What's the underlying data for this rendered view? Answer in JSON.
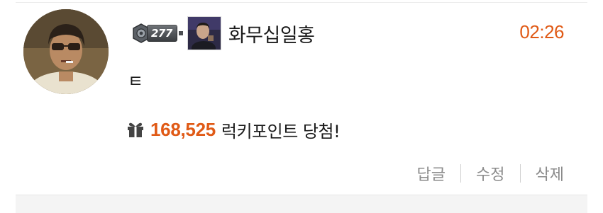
{
  "comment": {
    "level": "277",
    "nickname": "화무십일홍",
    "time": "02:26",
    "text": "ㅌ",
    "lucky": {
      "points": "168,525",
      "label": "럭키포인트 당첨!"
    },
    "actions": {
      "reply": "답글",
      "edit": "수정",
      "delete": "삭제"
    }
  },
  "icons": {
    "avatar": "user-photo-avatar",
    "level": "level-emblem-icon",
    "mini_avatar": "profile-thumbnail",
    "gift": "gift-icon"
  },
  "colors": {
    "accent": "#e05a16",
    "text": "#1a1a1a",
    "muted": "#8b8b8b"
  }
}
